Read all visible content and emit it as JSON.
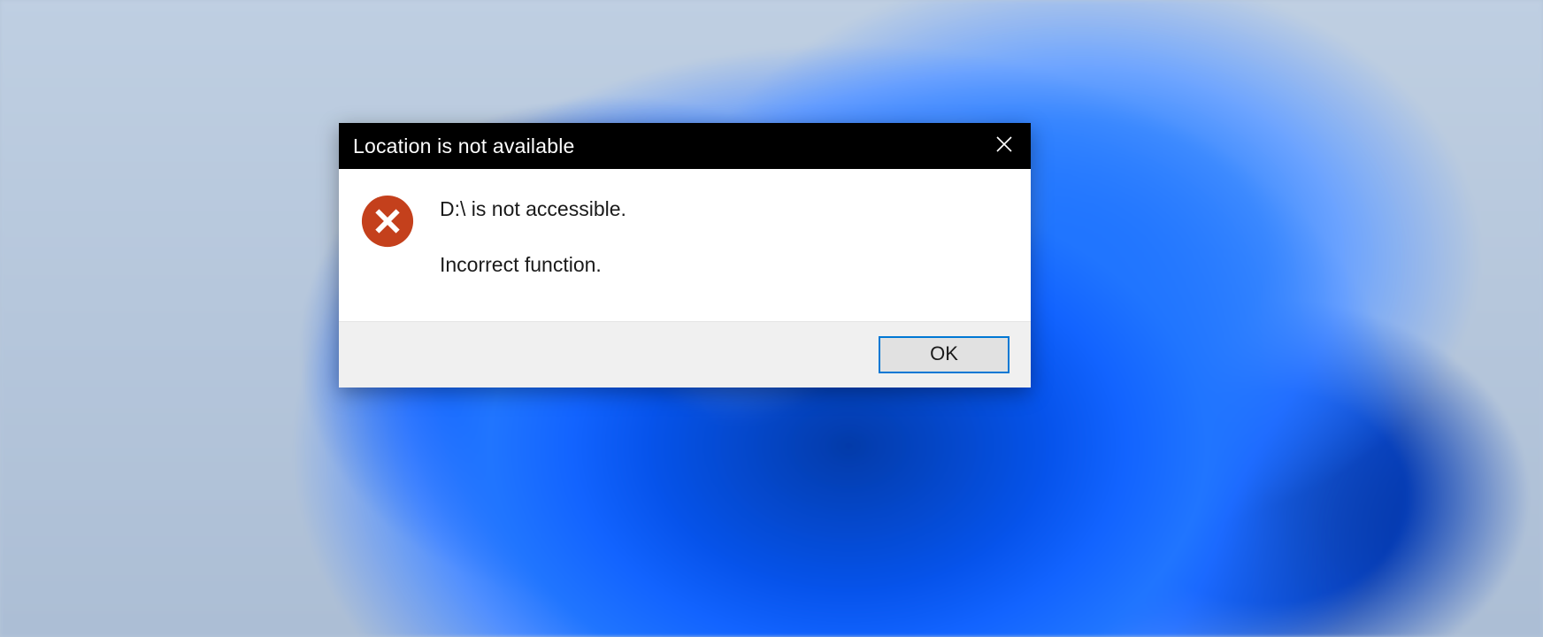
{
  "dialog": {
    "title": "Location is not available",
    "message_primary": "D:\\ is not accessible.",
    "message_secondary": "Incorrect function.",
    "ok_label": "OK"
  }
}
